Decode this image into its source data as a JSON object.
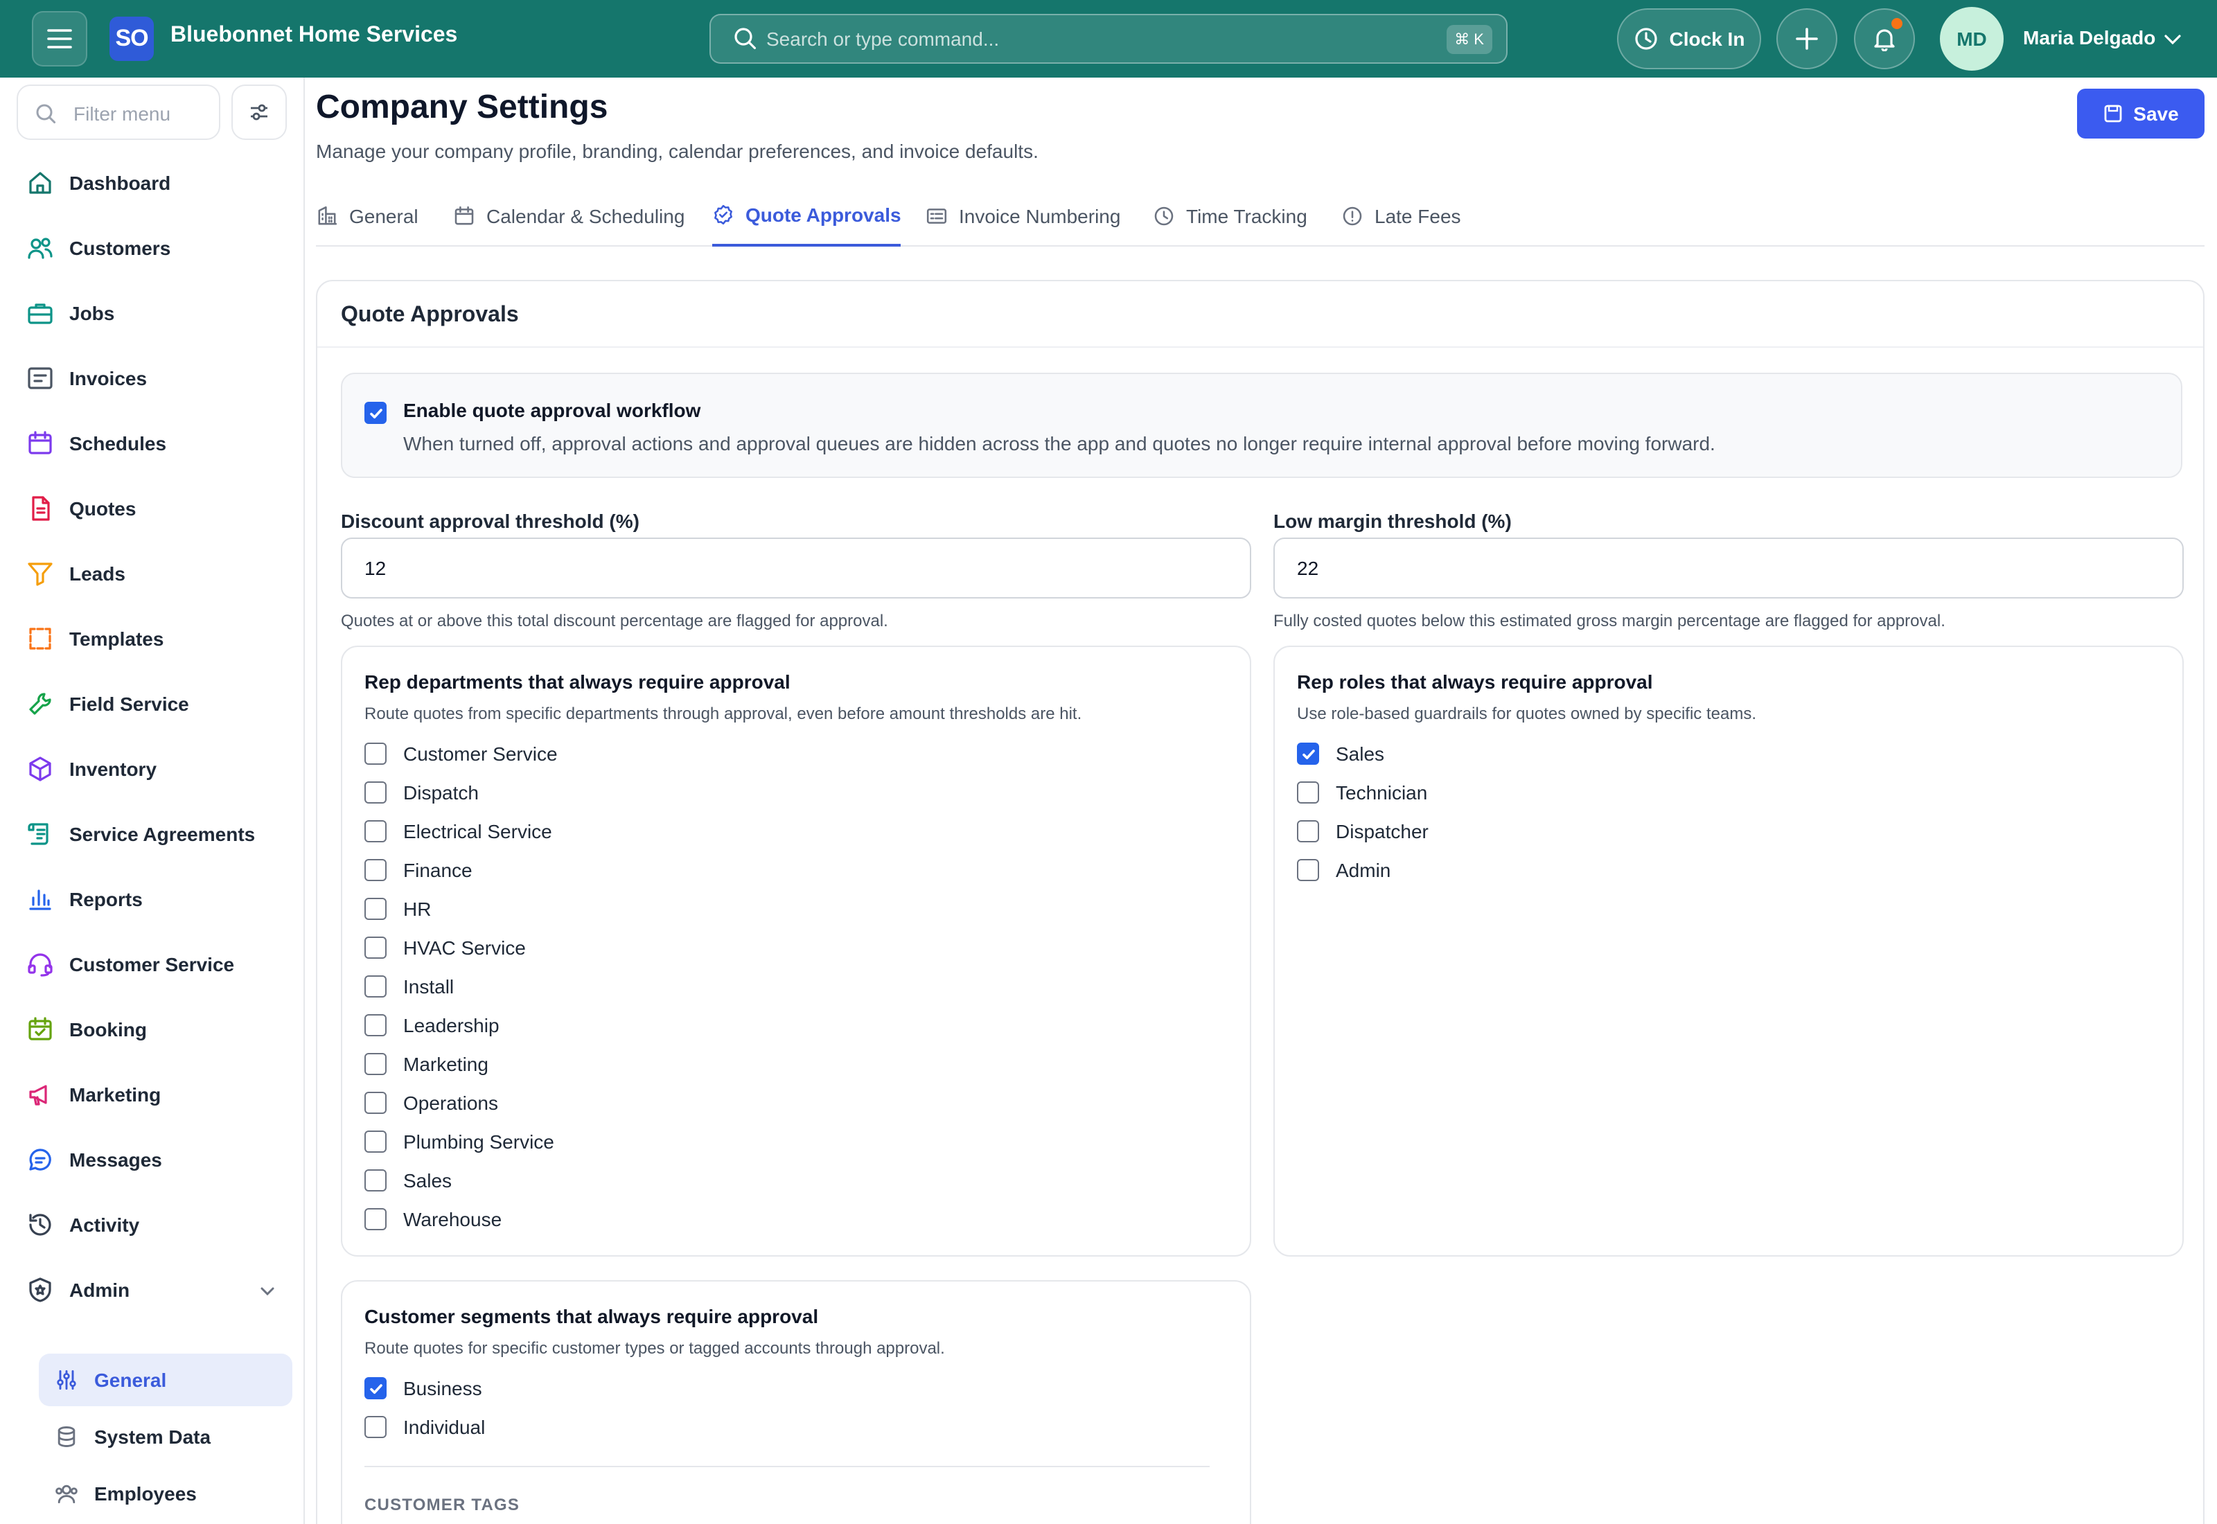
{
  "header": {
    "logo_text": "SO",
    "company_name": "Bluebonnet Home Services",
    "search_placeholder": "Search or type command...",
    "search_shortcut": "⌘ K",
    "clock_in_label": "Clock In",
    "user_initials": "MD",
    "user_name": "Maria Delgado",
    "notification_dot_color": "#f97316"
  },
  "sidebar": {
    "filter_placeholder": "Filter menu",
    "items": [
      {
        "label": "Dashboard",
        "icon": "home-icon",
        "color": "#15766c"
      },
      {
        "label": "Customers",
        "icon": "users-icon",
        "color": "#0d9488"
      },
      {
        "label": "Jobs",
        "icon": "briefcase-icon",
        "color": "#0d9488"
      },
      {
        "label": "Invoices",
        "icon": "invoice-icon",
        "color": "#4b5563"
      },
      {
        "label": "Schedules",
        "icon": "calendar-icon",
        "color": "#7c3aed"
      },
      {
        "label": "Quotes",
        "icon": "quote-doc-icon",
        "color": "#e11d48"
      },
      {
        "label": "Leads",
        "icon": "funnel-icon",
        "color": "#f59e0b"
      },
      {
        "label": "Templates",
        "icon": "template-icon",
        "color": "#f97316"
      },
      {
        "label": "Field Service",
        "icon": "wrench-icon",
        "color": "#16a34a"
      },
      {
        "label": "Inventory",
        "icon": "box-icon",
        "color": "#7c3aed"
      },
      {
        "label": "Service Agreements",
        "icon": "scroll-icon",
        "color": "#0d9488"
      },
      {
        "label": "Reports",
        "icon": "bar-chart-icon",
        "color": "#2563eb"
      },
      {
        "label": "Customer Service",
        "icon": "headset-icon",
        "color": "#9333ea"
      },
      {
        "label": "Booking",
        "icon": "calendar-check-icon",
        "color": "#65a30d"
      },
      {
        "label": "Marketing",
        "icon": "megaphone-icon",
        "color": "#db2777"
      },
      {
        "label": "Messages",
        "icon": "chat-icon",
        "color": "#2563eb"
      },
      {
        "label": "Activity",
        "icon": "history-icon",
        "color": "#374151"
      },
      {
        "label": "Admin",
        "icon": "shield-icon",
        "color": "#374151"
      }
    ],
    "admin_sub_items": [
      {
        "label": "General",
        "icon": "sliders-icon",
        "active": true
      },
      {
        "label": "System Data",
        "icon": "database-icon",
        "active": false
      },
      {
        "label": "Employees",
        "icon": "employees-icon",
        "active": false
      }
    ]
  },
  "page": {
    "title": "Company Settings",
    "subtitle": "Manage your company profile, branding, calendar preferences, and invoice defaults.",
    "save_label": "Save",
    "accent_color": "#3b5bdb"
  },
  "tabs": [
    {
      "label": "General",
      "icon": "building-icon",
      "active": false
    },
    {
      "label": "Calendar & Scheduling",
      "icon": "calendar-icon",
      "active": false
    },
    {
      "label": "Quote Approvals",
      "icon": "badge-check-icon",
      "active": true
    },
    {
      "label": "Invoice Numbering",
      "icon": "numbering-icon",
      "active": false
    },
    {
      "label": "Time Tracking",
      "icon": "clock-icon",
      "active": false
    },
    {
      "label": "Late Fees",
      "icon": "alert-circle-icon",
      "active": false
    }
  ],
  "quote_approvals": {
    "card_title": "Quote Approvals",
    "enable": {
      "checked": true,
      "title": "Enable quote approval workflow",
      "description": "When turned off, approval actions and approval queues are hidden across the app and quotes no longer require internal approval before moving forward."
    },
    "discount_threshold": {
      "label": "Discount approval threshold (%)",
      "value": "12",
      "help": "Quotes at or above this total discount percentage are flagged for approval."
    },
    "margin_threshold": {
      "label": "Low margin threshold (%)",
      "value": "22",
      "help": "Fully costed quotes below this estimated gross margin percentage are flagged for approval."
    },
    "departments": {
      "title": "Rep departments that always require approval",
      "description": "Route quotes from specific departments through approval, even before amount thresholds are hit.",
      "options": [
        {
          "label": "Customer Service",
          "checked": false
        },
        {
          "label": "Dispatch",
          "checked": false
        },
        {
          "label": "Electrical Service",
          "checked": false
        },
        {
          "label": "Finance",
          "checked": false
        },
        {
          "label": "HR",
          "checked": false
        },
        {
          "label": "HVAC Service",
          "checked": false
        },
        {
          "label": "Install",
          "checked": false
        },
        {
          "label": "Leadership",
          "checked": false
        },
        {
          "label": "Marketing",
          "checked": false
        },
        {
          "label": "Operations",
          "checked": false
        },
        {
          "label": "Plumbing Service",
          "checked": false
        },
        {
          "label": "Sales",
          "checked": false
        },
        {
          "label": "Warehouse",
          "checked": false
        }
      ]
    },
    "roles": {
      "title": "Rep roles that always require approval",
      "description": "Use role-based guardrails for quotes owned by specific teams.",
      "options": [
        {
          "label": "Sales",
          "checked": true
        },
        {
          "label": "Technician",
          "checked": false
        },
        {
          "label": "Dispatcher",
          "checked": false
        },
        {
          "label": "Admin",
          "checked": false
        }
      ]
    },
    "segments": {
      "title": "Customer segments that always require approval",
      "description": "Route quotes for specific customer types or tagged accounts through approval.",
      "options": [
        {
          "label": "Business",
          "checked": true
        },
        {
          "label": "Individual",
          "checked": false
        }
      ],
      "tags_caption": "CUSTOMER TAGS"
    }
  }
}
